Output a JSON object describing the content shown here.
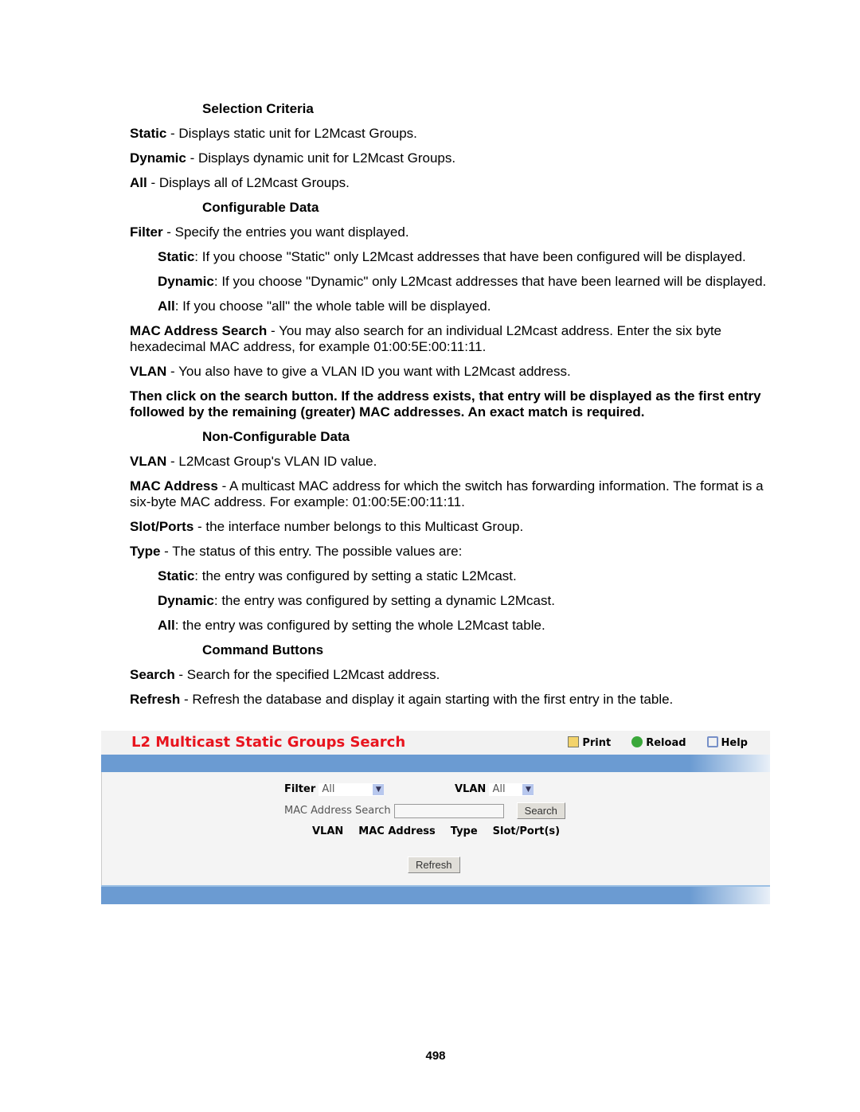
{
  "doc": {
    "h1": "Selection Criteria",
    "p1b": "Static",
    "p1": " - Displays static unit for L2Mcast Groups.",
    "p2b": "Dynamic",
    "p2": " - Displays dynamic unit for L2Mcast Groups.",
    "p3b": "All",
    "p3": " - Displays all of L2Mcast Groups.",
    "h2": "Configurable Data",
    "p4b": "Filter",
    "p4": " - Specify the entries you want displayed.",
    "p5b": "Static",
    "p5": ": If you choose \"Static\" only L2Mcast addresses that have been configured will be displayed.",
    "p6b": "Dynamic",
    "p6": ": If you choose \"Dynamic\" only L2Mcast addresses that have been learned will be displayed.",
    "p7b": "All",
    "p7": ": If you choose \"all\" the whole table will be displayed.",
    "p8b": "MAC Address Search",
    "p8": " - You may also search for an individual L2Mcast address. Enter the six byte hexadecimal MAC address, for example 01:00:5E:00:11:11.",
    "p9b": "VLAN",
    "p9": " - You also have to give a VLAN ID you want with L2Mcast address.",
    "p10": "Then click on the search button. If the address exists, that entry will be displayed as the first entry followed by the remaining (greater) MAC addresses. An exact match is required.",
    "h3": "Non-Configurable Data",
    "p11b": "VLAN",
    "p11": " - L2Mcast Group's VLAN ID value.",
    "p12b": "MAC Address",
    "p12": " - A multicast MAC address for which the switch has forwarding information. The format is a six-byte MAC address. For example: 01:00:5E:00:11:11.",
    "p13b": "Slot/Ports",
    "p13": " - the interface number belongs to this Multicast Group.",
    "p14b": "Type",
    "p14": " - The status of this entry. The possible values are:",
    "p15b": "Static",
    "p15": ": the entry was configured by setting a static L2Mcast.",
    "p16b": "Dynamic",
    "p16": ": the entry was configured by setting a dynamic L2Mcast.",
    "p17b": "All",
    "p17": ": the entry was configured by setting the whole L2Mcast table.",
    "h4": "Command Buttons",
    "p18b": "Search",
    "p18": " - Search for the specified L2Mcast address.",
    "p19b": "Refresh",
    "p19": " - Refresh the database and display it again starting with the first entry in the table."
  },
  "ui": {
    "title": "L2 Multicast Static Groups Search",
    "title_color": "#e8141e",
    "bar_color": "#6b9bd2",
    "print": "Print",
    "reload": "Reload",
    "help": "Help",
    "filter_label": "Filter",
    "filter_value": "All",
    "vlan_label": "VLAN",
    "vlan_value": "All",
    "mac_label": "MAC Address Search",
    "mac_value": "",
    "search_btn": "Search",
    "columns": [
      "VLAN",
      "MAC Address",
      "Type",
      "Slot/Port(s)"
    ],
    "refresh_btn": "Refresh"
  },
  "page_number": "498"
}
